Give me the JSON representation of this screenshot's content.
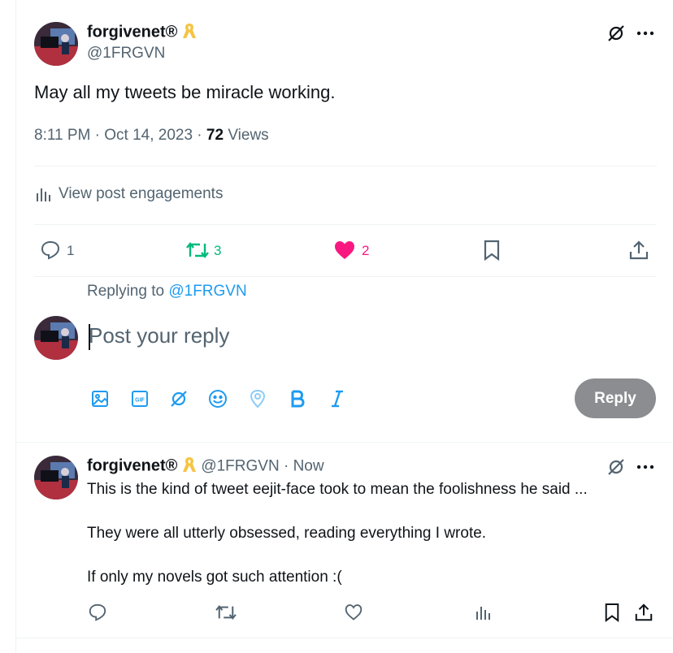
{
  "main_tweet": {
    "author_name": "forgivenet®",
    "author_handle": "@1FRGVN",
    "text": "May all my tweets be miracle working.",
    "time": "8:11 PM · Oct 14, 2023 · ",
    "views_count": "72",
    "views_label": " Views",
    "engagements_label": "View post engagements",
    "reply_count": "1",
    "retweet_count": "3",
    "like_count": "2"
  },
  "composer": {
    "replying_prefix": "Replying to ",
    "replying_handle": "@1FRGVN",
    "placeholder": "Post your reply",
    "reply_button": "Reply"
  },
  "reply_tweet": {
    "author_name": "forgivenet®",
    "meta": "@1FRGVN · Now",
    "line1": "This is the kind of tweet eejit-face took to mean the foolishness he said ...",
    "line2": "They were all utterly obsessed, reading everything I wrote.",
    "line3": "If only my novels got such attention :("
  },
  "colors": {
    "accent": "#1d9bf0",
    "retweet": "#00ba7c",
    "like": "#f91880",
    "muted": "#536471",
    "button_disabled": "#8b8d90"
  },
  "icons": [
    "chain-icon",
    "more-icon",
    "ribbon-icon",
    "analytics-icon",
    "reply-icon",
    "retweet-icon",
    "heart-icon",
    "bookmark-icon",
    "share-icon",
    "image-icon",
    "gif-icon",
    "emoji-icon",
    "location-icon",
    "bold-icon",
    "italic-icon"
  ]
}
